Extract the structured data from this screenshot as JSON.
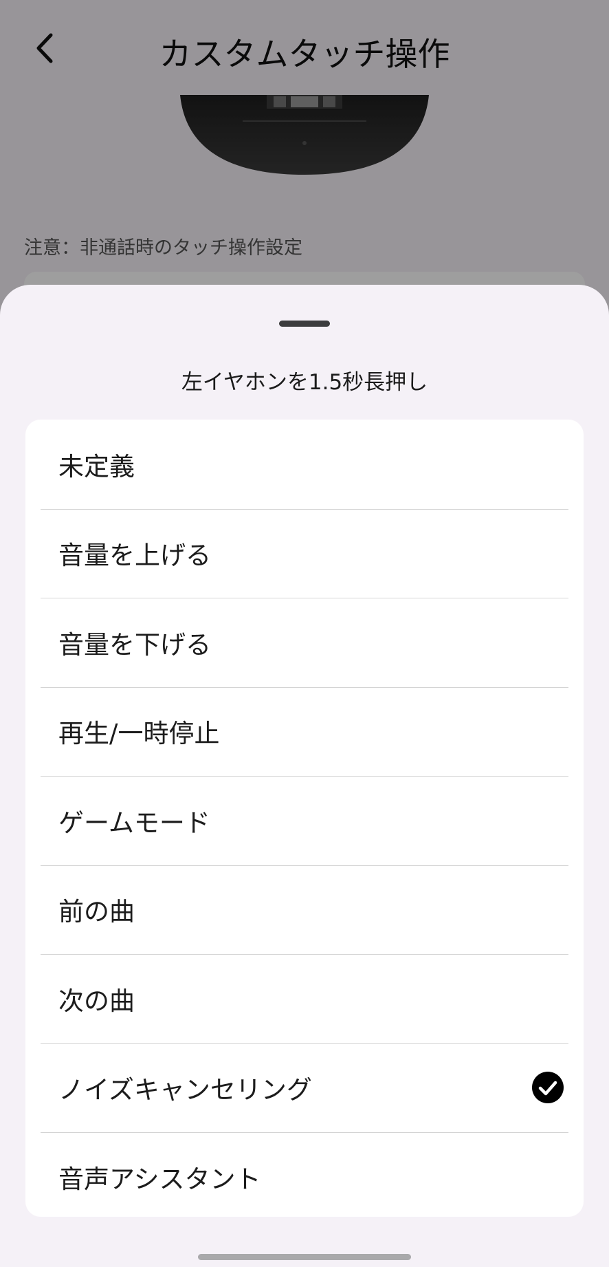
{
  "header": {
    "title": "カスタムタッチ操作",
    "back_icon": "chevron-left-icon"
  },
  "page": {
    "note": "注意：非通話時のタッチ操作設定"
  },
  "sheet": {
    "title": "左イヤホンを1.5秒長押し",
    "options": [
      {
        "label": "未定義",
        "selected": false
      },
      {
        "label": "音量を上げる",
        "selected": false
      },
      {
        "label": "音量を下げる",
        "selected": false
      },
      {
        "label": "再生/一時停止",
        "selected": false
      },
      {
        "label": "ゲームモード",
        "selected": false
      },
      {
        "label": "前の曲",
        "selected": false
      },
      {
        "label": "次の曲",
        "selected": false
      },
      {
        "label": "ノイズキャンセリング",
        "selected": true
      },
      {
        "label": "音声アシスタント",
        "selected": false
      }
    ],
    "selected_icon": "check-circle-icon"
  },
  "colors": {
    "sheet_bg": "#f5f1f7",
    "card_bg": "#ffffff",
    "text": "#1c1c1c",
    "check": "#000000"
  }
}
